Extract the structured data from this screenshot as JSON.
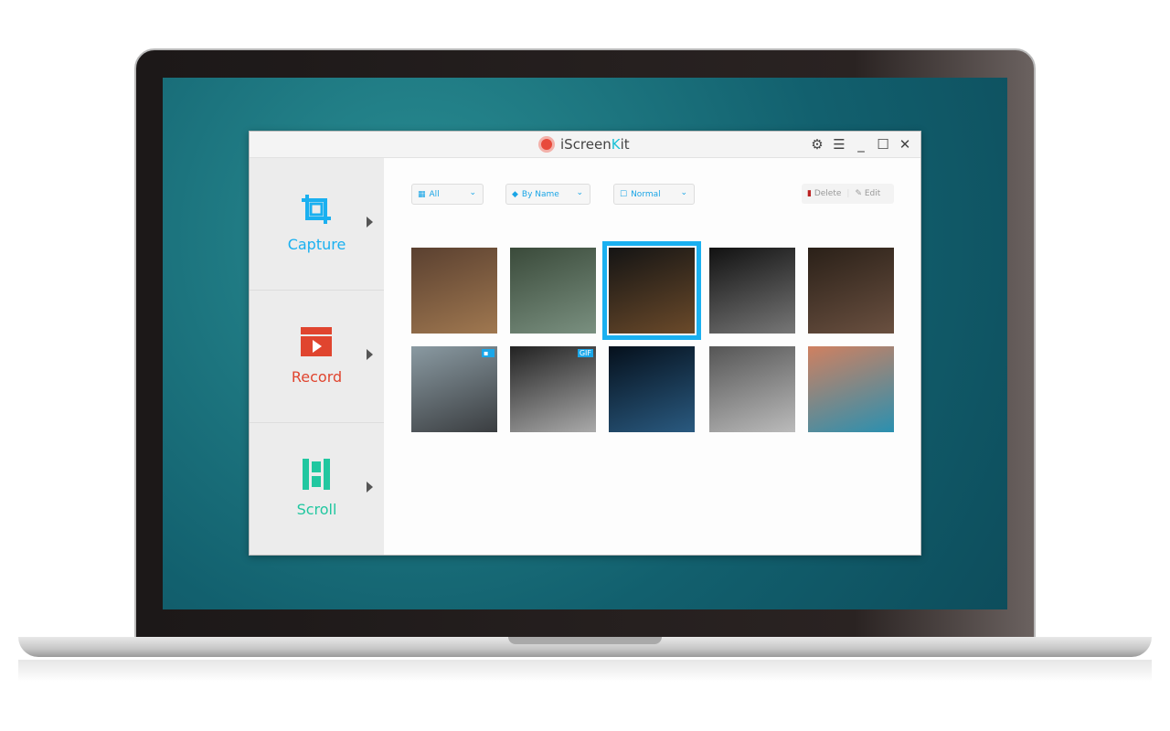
{
  "app": {
    "title_prefix": "iScreen",
    "title_k": "K",
    "title_suffix": "it"
  },
  "window_controls": {
    "settings": "⚙",
    "menu": "☰",
    "minimize": "_",
    "maximize": "☐",
    "close": "✕"
  },
  "sidebar": {
    "items": [
      {
        "label": "Capture",
        "color": "#1ab0f0",
        "icon": "crop-icon"
      },
      {
        "label": "Record",
        "color": "#e0452f",
        "icon": "clapperboard-play-icon"
      },
      {
        "label": "Scroll",
        "color": "#21c7a0",
        "icon": "scroll-icon"
      }
    ]
  },
  "toolbar": {
    "filter": "All",
    "sort": "By Name",
    "mode": "Normal",
    "delete": "Delete",
    "edit": "Edit"
  },
  "gallery": {
    "selected_index": 2,
    "items": [
      {
        "colors": [
          "#5a4030",
          "#a07850"
        ],
        "badge": ""
      },
      {
        "colors": [
          "#3a4a3a",
          "#7a9080"
        ],
        "badge": ""
      },
      {
        "colors": [
          "#141414",
          "#6b4a2a"
        ],
        "badge": ""
      },
      {
        "colors": [
          "#111",
          "#777"
        ],
        "badge": ""
      },
      {
        "colors": [
          "#2a2018",
          "#6a5040"
        ],
        "badge": ""
      },
      {
        "colors": [
          "#8a9aa2",
          "#3a3d40"
        ],
        "badge": "▪"
      },
      {
        "colors": [
          "#222",
          "#aaa"
        ],
        "badge": "GIF"
      },
      {
        "colors": [
          "#05101c",
          "#2a5a80"
        ],
        "badge": ""
      },
      {
        "colors": [
          "#555",
          "#bbb"
        ],
        "badge": ""
      },
      {
        "colors": [
          "#d08060",
          "#2a90b0"
        ],
        "badge": ""
      }
    ]
  }
}
